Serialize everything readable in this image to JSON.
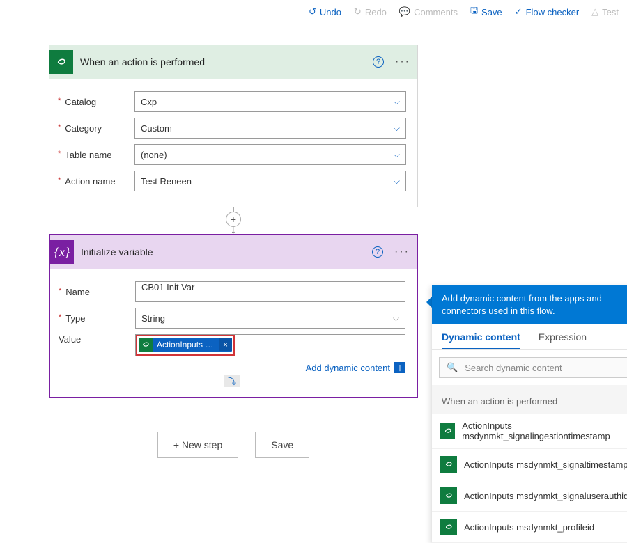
{
  "toolbar": {
    "undo": "Undo",
    "redo": "Redo",
    "comments": "Comments",
    "save": "Save",
    "flow_checker": "Flow checker",
    "test": "Test"
  },
  "card1": {
    "title": "When an action is performed",
    "fields": {
      "catalog": {
        "label": "Catalog",
        "value": "Cxp"
      },
      "category": {
        "label": "Category",
        "value": "Custom"
      },
      "table": {
        "label": "Table name",
        "value": "(none)"
      },
      "action": {
        "label": "Action name",
        "value": "Test Reneen"
      }
    }
  },
  "card2": {
    "title": "Initialize variable",
    "fields": {
      "name": {
        "label": "Name",
        "value": "CB01 Init Var"
      },
      "type": {
        "label": "Type",
        "value": "String"
      },
      "value": {
        "label": "Value",
        "pill_text": "ActionInputs m..."
      }
    },
    "dyn_link": "Add dynamic content"
  },
  "buttons": {
    "new_step": "+ New step",
    "save": "Save"
  },
  "dynamic": {
    "header": "Add dynamic content from the apps and connectors used in this flow.",
    "tab_dynamic": "Dynamic content",
    "tab_expression": "Expression",
    "search_placeholder": "Search dynamic content",
    "section": "When an action is performed",
    "items": [
      "ActionInputs msdynmkt_signalingestiontimestamp",
      "ActionInputs msdynmkt_signaltimestamp",
      "ActionInputs msdynmkt_signaluserauthid",
      "ActionInputs msdynmkt_profileid"
    ]
  }
}
